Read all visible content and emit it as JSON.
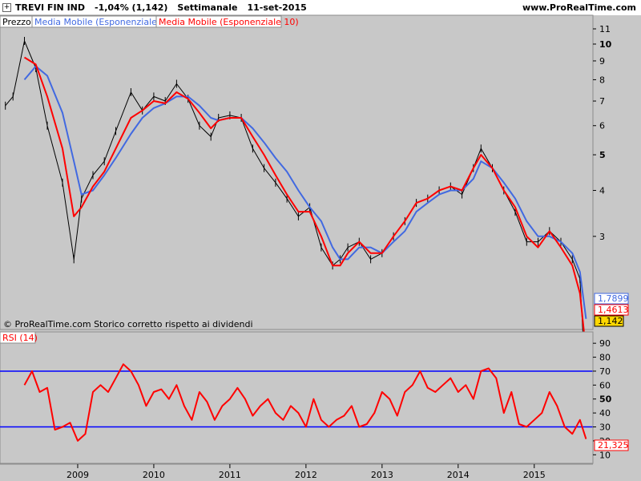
{
  "header": {
    "symbol": "TREVI FIN IND",
    "change": "-1,04% (1,142)",
    "timeframe": "Settimanale",
    "date": "11-set-2015",
    "site": "www.ProRealTime.com"
  },
  "price_panel": {
    "legend_price": "Prezzo",
    "legend_ma20": "Media Mobile (Esponenziale 20)",
    "legend_ma10": "Media Mobile (Esponenziale 10)",
    "footnote": "© ProRealTime.com  Storico corretto rispetto ai dividendi",
    "badges": {
      "ma20": "1,7899",
      "ma10": "1,4613",
      "last": "1,142"
    }
  },
  "rsi_panel": {
    "legend": "RSI (14)",
    "badge": "21,325"
  },
  "colors": {
    "ma20": "#4169e1",
    "ma10": "#ff0000",
    "price": "#000000",
    "levels": "#0000ff",
    "last_badge": "#ffd700",
    "panel_bg": "#c8c8c8"
  },
  "chart_data": [
    {
      "type": "line",
      "title": "",
      "scale": "log",
      "x": [
        2008.05,
        2008.15,
        2008.3,
        2008.45,
        2008.6,
        2008.8,
        2008.95,
        2009.05,
        2009.2,
        2009.35,
        2009.5,
        2009.7,
        2009.85,
        2010.0,
        2010.15,
        2010.3,
        2010.45,
        2010.6,
        2010.75,
        2010.85,
        2011.0,
        2011.15,
        2011.3,
        2011.45,
        2011.6,
        2011.75,
        2011.9,
        2012.05,
        2012.2,
        2012.35,
        2012.45,
        2012.55,
        2012.7,
        2012.85,
        2013.0,
        2013.15,
        2013.3,
        2013.45,
        2013.6,
        2013.75,
        2013.9,
        2014.05,
        2014.2,
        2014.3,
        2014.45,
        2014.6,
        2014.75,
        2014.9,
        2015.05,
        2015.2,
        2015.35,
        2015.5,
        2015.6,
        2015.68
      ],
      "series": [
        {
          "name": "Prezzo",
          "values": [
            6.8,
            7.2,
            10.2,
            8.6,
            6.0,
            4.2,
            2.6,
            3.8,
            4.4,
            4.8,
            5.8,
            7.4,
            6.6,
            7.2,
            7.0,
            7.8,
            7.1,
            6.0,
            5.6,
            6.3,
            6.4,
            6.3,
            5.2,
            4.6,
            4.2,
            3.8,
            3.4,
            3.6,
            2.8,
            2.5,
            2.6,
            2.8,
            2.9,
            2.6,
            2.7,
            3.0,
            3.3,
            3.7,
            3.8,
            4.0,
            4.1,
            3.9,
            4.6,
            5.2,
            4.6,
            4.0,
            3.5,
            2.9,
            2.9,
            3.1,
            2.9,
            2.6,
            2.3,
            1.142
          ]
        },
        {
          "name": "Media Mobile (Esponenziale 20)",
          "values": [
            null,
            null,
            8.0,
            8.7,
            8.2,
            6.5,
            4.8,
            3.9,
            4.0,
            4.4,
            4.9,
            5.7,
            6.3,
            6.7,
            6.9,
            7.2,
            7.2,
            6.8,
            6.3,
            6.2,
            6.3,
            6.3,
            5.9,
            5.4,
            4.9,
            4.5,
            4.0,
            3.6,
            3.3,
            2.8,
            2.6,
            2.6,
            2.8,
            2.8,
            2.7,
            2.9,
            3.1,
            3.5,
            3.7,
            3.9,
            4.0,
            4.0,
            4.3,
            4.8,
            4.6,
            4.2,
            3.8,
            3.3,
            3.0,
            3.0,
            2.9,
            2.7,
            2.4,
            1.7899
          ]
        },
        {
          "name": "Media Mobile (Esponenziale 10)",
          "values": [
            null,
            null,
            9.2,
            8.8,
            7.2,
            5.2,
            3.4,
            3.6,
            4.1,
            4.5,
            5.2,
            6.3,
            6.6,
            7.0,
            6.9,
            7.4,
            7.1,
            6.5,
            5.9,
            6.2,
            6.3,
            6.3,
            5.6,
            5.0,
            4.4,
            3.9,
            3.5,
            3.5,
            3.0,
            2.5,
            2.5,
            2.7,
            2.9,
            2.7,
            2.7,
            3.0,
            3.3,
            3.7,
            3.8,
            4.0,
            4.1,
            4.0,
            4.6,
            5.0,
            4.6,
            4.0,
            3.6,
            3.0,
            2.8,
            3.1,
            2.8,
            2.5,
            2.1,
            1.4613
          ]
        }
      ],
      "yticks": [
        3,
        4,
        5,
        6,
        7,
        8,
        9,
        10,
        11
      ],
      "xticks": [
        "2009",
        "2010",
        "2011",
        "2012",
        "2013",
        "2014",
        "2015"
      ],
      "xlim": [
        2008,
        2015.75
      ],
      "ylim": [
        1.7,
        11.8
      ],
      "grid": false,
      "legend": "top-left"
    },
    {
      "type": "line",
      "title": "",
      "x": [
        2008.3,
        2008.4,
        2008.5,
        2008.6,
        2008.7,
        2008.8,
        2008.9,
        2009.0,
        2009.1,
        2009.2,
        2009.3,
        2009.4,
        2009.5,
        2009.6,
        2009.7,
        2009.8,
        2009.9,
        2010.0,
        2010.1,
        2010.2,
        2010.3,
        2010.4,
        2010.5,
        2010.6,
        2010.7,
        2010.8,
        2010.9,
        2011.0,
        2011.1,
        2011.2,
        2011.3,
        2011.4,
        2011.5,
        2011.6,
        2011.7,
        2011.8,
        2011.9,
        2012.0,
        2012.1,
        2012.2,
        2012.3,
        2012.4,
        2012.5,
        2012.6,
        2012.7,
        2012.8,
        2012.9,
        2013.0,
        2013.1,
        2013.2,
        2013.3,
        2013.4,
        2013.5,
        2013.6,
        2013.7,
        2013.8,
        2013.9,
        2014.0,
        2014.1,
        2014.2,
        2014.3,
        2014.4,
        2014.5,
        2014.6,
        2014.7,
        2014.8,
        2014.9,
        2015.0,
        2015.1,
        2015.2,
        2015.3,
        2015.4,
        2015.5,
        2015.6,
        2015.68
      ],
      "series": [
        {
          "name": "RSI (14)",
          "values": [
            60,
            70,
            55,
            58,
            28,
            30,
            33,
            20,
            25,
            55,
            60,
            55,
            65,
            75,
            70,
            60,
            45,
            55,
            57,
            50,
            60,
            45,
            35,
            55,
            48,
            35,
            45,
            50,
            58,
            50,
            38,
            45,
            50,
            40,
            35,
            45,
            40,
            30,
            50,
            35,
            30,
            35,
            38,
            45,
            30,
            32,
            40,
            55,
            50,
            38,
            55,
            60,
            70,
            58,
            55,
            60,
            65,
            55,
            60,
            50,
            70,
            72,
            65,
            40,
            55,
            32,
            30,
            35,
            40,
            55,
            45,
            30,
            25,
            35,
            21.325
          ]
        }
      ],
      "yticks": [
        10,
        20,
        30,
        40,
        50,
        60,
        70,
        80,
        90
      ],
      "levels": [
        30,
        70
      ],
      "xlim": [
        2008,
        2015.75
      ],
      "ylim": [
        5,
        97
      ],
      "grid": false,
      "legend": "top-left"
    }
  ]
}
